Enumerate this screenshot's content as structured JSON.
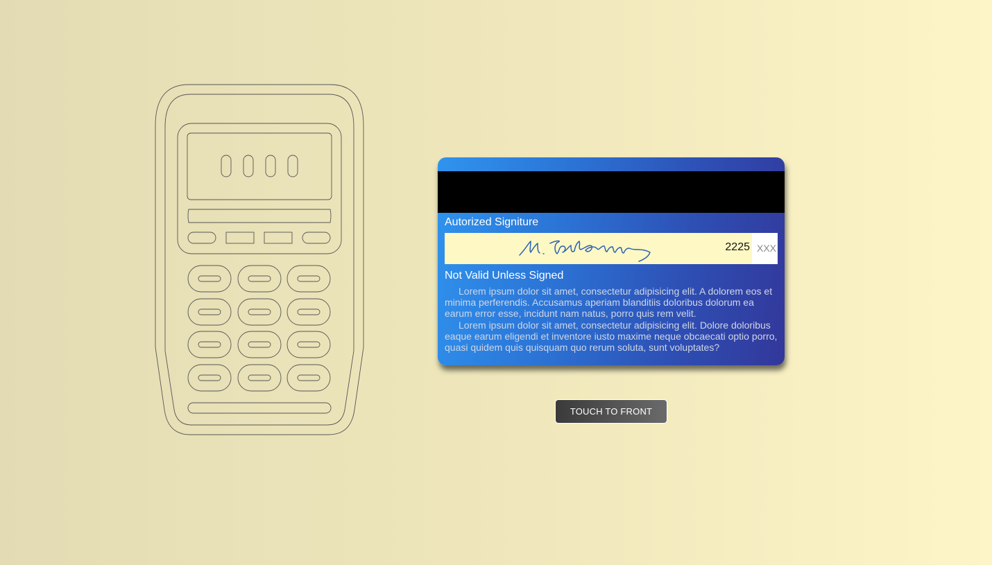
{
  "card_back": {
    "signature_label": "Autorized Signiture",
    "card_number_partial": "2225",
    "cvv_placeholder": "XXX",
    "not_valid_text": "Not Valid Unless Signed",
    "legal_paragraphs": [
      "Lorem ipsum dolor sit amet, consectetur adipisicing elit. A dolorem eos et minima perferendis. Accusamus aperiam blanditiis doloribus dolorum ea earum error esse, incidunt nam natus, porro quis rem velit.",
      "Lorem ipsum dolor sit amet, consectetur adipisicing elit. Dolore doloribus eaque earum eligendi et inventore iusto maxime neque obcaecati optio porro, quasi quidem quis quisquam quo rerum soluta, sunt voluptates?"
    ]
  },
  "actions": {
    "flip_label": "TOUCH TO FRONT"
  },
  "icons": {
    "terminal": "payment-terminal-icon",
    "signature": "handwritten-signature"
  },
  "colors": {
    "background_left": "#e3dbb3",
    "background_right": "#fdf5c7",
    "card_gradient_start": "#2f94ee",
    "card_gradient_end": "#33379a",
    "signature_strip": "#fef8c4",
    "button": "#4a4a4a"
  }
}
